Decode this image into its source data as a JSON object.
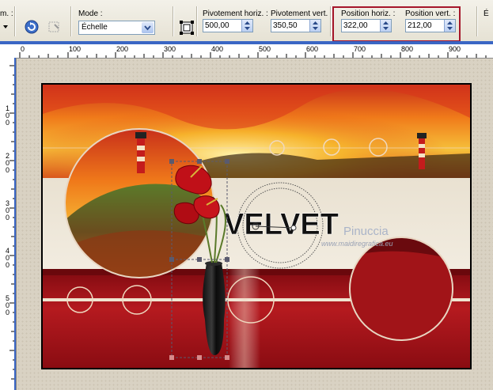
{
  "toolbar": {
    "cut_label": "m. :",
    "mode_label": "Mode :",
    "mode_value": "Échelle",
    "rot_h_label": "Pivotement horiz. :",
    "rot_h_value": "500,00",
    "rot_v_label": "Pivotement vert. :",
    "rot_v_value": "350,50",
    "pos_h_label": "Position horiz. :",
    "pos_h_value": "322,00",
    "pos_v_label": "Position vert. :",
    "pos_v_value": "212,00",
    "cut_right_label": "É"
  },
  "ruler_top": [
    "0",
    "100",
    "200",
    "300",
    "400",
    "500",
    "600",
    "700",
    "800",
    "900"
  ],
  "ruler_left": [
    "1\n0\n0",
    "2\n0\n0",
    "3\n0\n0",
    "4\n0\n0",
    "5\n0\n0"
  ],
  "artwork": {
    "title": "VELVET",
    "signature": "Pinuccia",
    "website": "www.maidiregrafica.eu"
  },
  "colors": {
    "accent_red": "#a5162a",
    "velvet_red": "#b21218",
    "cream": "#ebe3d4",
    "selection_box": "#5a5a6e"
  }
}
